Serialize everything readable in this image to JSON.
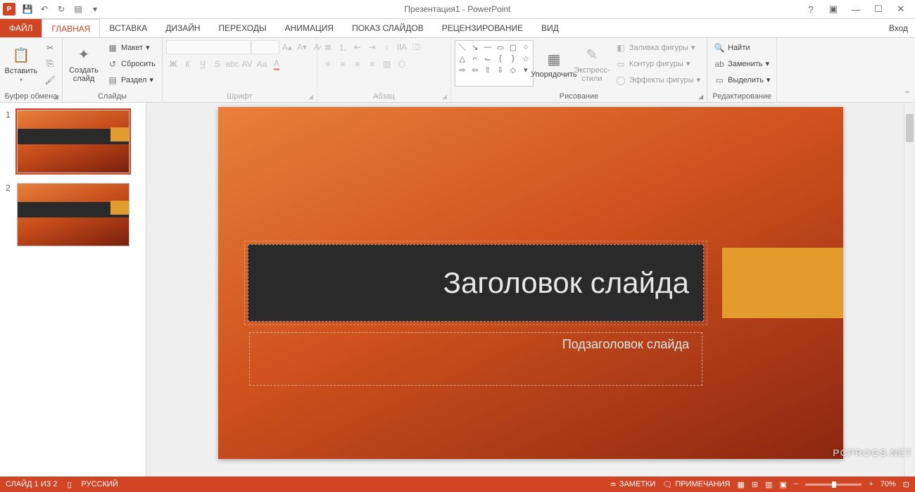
{
  "titlebar": {
    "title": "Презентация1 - PowerPoint"
  },
  "signin": "Вход",
  "tabs": {
    "file": "ФАЙЛ",
    "home": "ГЛАВНАЯ",
    "insert": "ВСТАВКА",
    "design": "ДИЗАЙН",
    "transitions": "ПЕРЕХОДЫ",
    "animations": "АНИМАЦИЯ",
    "slideshow": "ПОКАЗ СЛАЙДОВ",
    "review": "РЕЦЕНЗИРОВАНИЕ",
    "view": "ВИД"
  },
  "ribbon": {
    "clipboard": {
      "label": "Буфер обмена",
      "paste": "Вставить"
    },
    "slides": {
      "label": "Слайды",
      "newslide": "Создать\nслайд",
      "layout": "Макет",
      "reset": "Сбросить",
      "section": "Раздел"
    },
    "font": {
      "label": "Шрифт"
    },
    "paragraph": {
      "label": "Абзац"
    },
    "drawing": {
      "label": "Рисование",
      "arrange": "Упорядочить",
      "quickstyles": "Экспресс-\nстили",
      "fill": "Заливка фигуры",
      "outline": "Контур фигуры",
      "effects": "Эффекты фигуры"
    },
    "editing": {
      "label": "Редактирование",
      "find": "Найти",
      "replace": "Заменить",
      "select": "Выделить"
    }
  },
  "thumbs": {
    "n1": "1",
    "n2": "2"
  },
  "slide": {
    "title": "Заголовок слайда",
    "subtitle": "Подзаголовок слайда"
  },
  "status": {
    "counter": "СЛАЙД 1 ИЗ 2",
    "lang": "РУССКИЙ",
    "notes": "ЗАМЕТКИ",
    "comments": "ПРИМЕЧАНИЯ",
    "zoom": "70%"
  },
  "watermark": "PCPROGS.NET"
}
